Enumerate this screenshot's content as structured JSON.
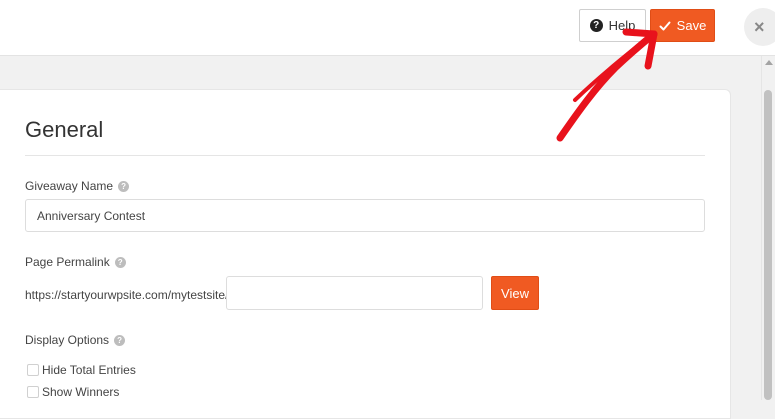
{
  "toolbar": {
    "help_label": "Help",
    "save_label": "Save",
    "close_glyph": "×"
  },
  "section": {
    "title": "General"
  },
  "giveaway_name": {
    "label": "Giveaway Name",
    "value": "Anniversary Contest"
  },
  "permalink": {
    "label": "Page Permalink",
    "prefix": "https://startyourwpsite.com/mytestsite/",
    "value": "",
    "view_label": "View"
  },
  "display_options": {
    "label": "Display Options",
    "options": [
      {
        "label": "Hide Total Entries",
        "checked": false
      },
      {
        "label": "Show Winners",
        "checked": false
      }
    ]
  },
  "colors": {
    "accent": "#f05a22",
    "annotation": "#e8121c"
  }
}
